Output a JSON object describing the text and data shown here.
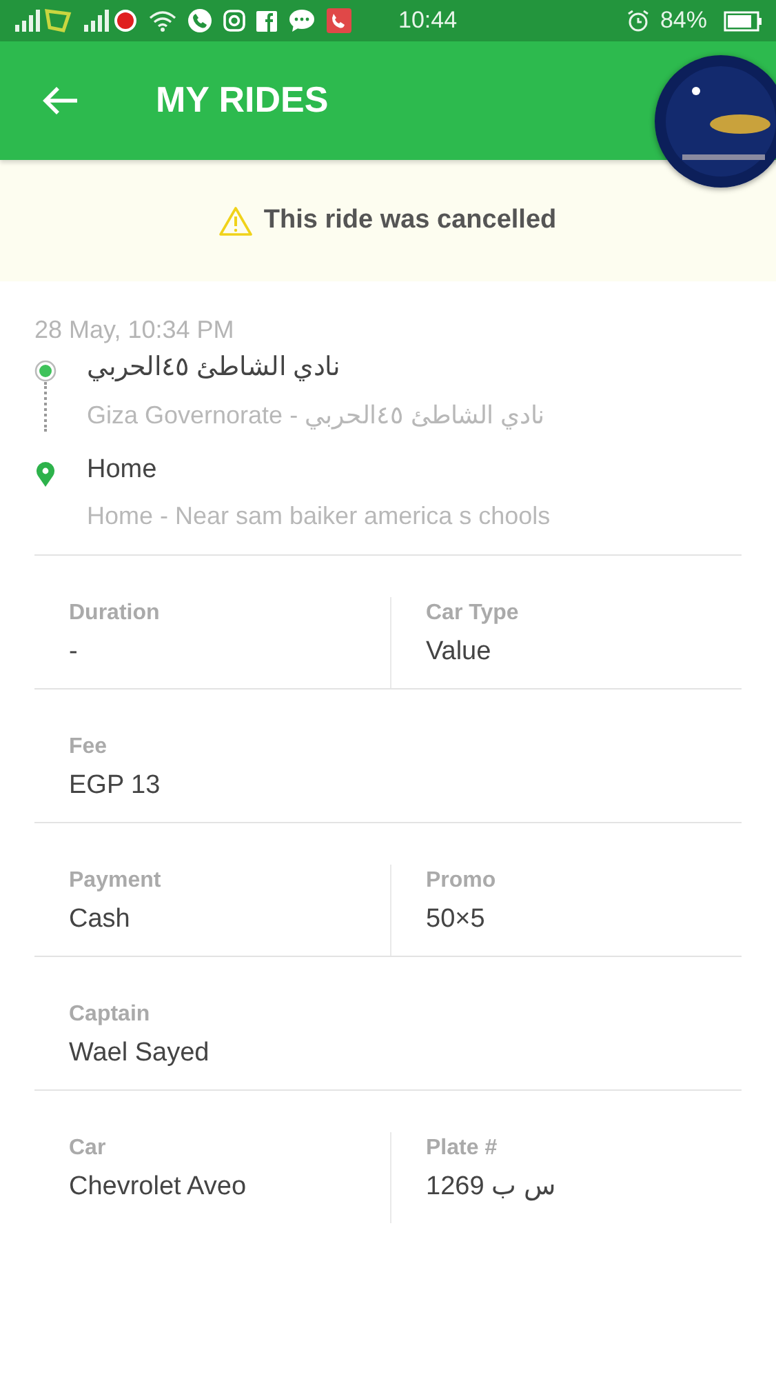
{
  "status_bar": {
    "time": "10:44",
    "battery": "84%"
  },
  "app_bar": {
    "title": "MY RIDES"
  },
  "notice": {
    "text": "This ride was cancelled"
  },
  "ride": {
    "datetime": "28 May, 10:34 PM",
    "stops": [
      {
        "kind": "pickup",
        "name": "نادي الشاطئ ٤٥الحربي",
        "address": "Giza Governorate - نادي الشاطئ ٤٥الحربي"
      },
      {
        "kind": "dropoff",
        "name": "Home",
        "address": "Home - Near sam baiker america s chools"
      }
    ]
  },
  "details": [
    {
      "cells": [
        {
          "label": "Duration",
          "value": "-"
        },
        {
          "label": "Car Type",
          "value": "Value"
        }
      ]
    },
    {
      "cells": [
        {
          "label": "Fee",
          "value": "EGP 13"
        }
      ]
    },
    {
      "cells": [
        {
          "label": "Payment",
          "value": "Cash"
        },
        {
          "label": "Promo",
          "value": "50×5"
        }
      ]
    },
    {
      "cells": [
        {
          "label": "Captain",
          "value": "Wael  Sayed"
        }
      ]
    },
    {
      "cells": [
        {
          "label": "Car",
          "value": "Chevrolet Aveo"
        },
        {
          "label": "Plate #",
          "value": "1269 س ب"
        }
      ]
    }
  ]
}
